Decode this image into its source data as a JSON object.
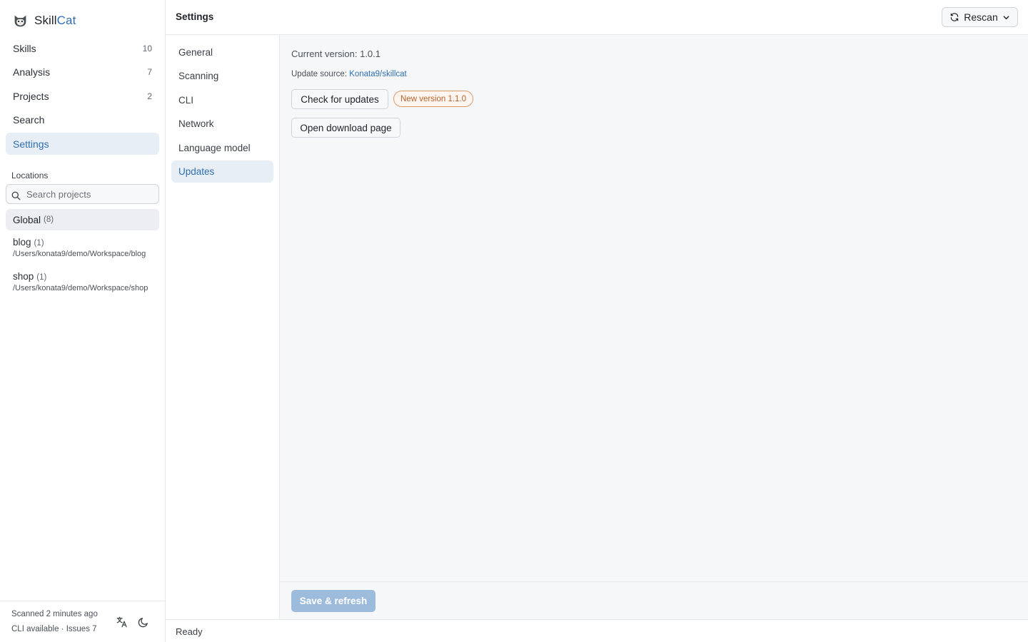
{
  "brand": {
    "name_part1": "Skill",
    "name_part2": "Cat",
    "logo_icon": "cat-logo-icon",
    "accent": "#2f6fb1"
  },
  "sidebar": {
    "items": [
      {
        "label": "Skills",
        "count": "10"
      },
      {
        "label": "Analysis",
        "count": "7"
      },
      {
        "label": "Projects",
        "count": "2"
      },
      {
        "label": "Search",
        "count": ""
      },
      {
        "label": "Settings",
        "count": "",
        "active": true
      }
    ],
    "locations_title": "Locations",
    "search_placeholder": "Search projects",
    "global": {
      "label": "Global",
      "count": "(8)"
    },
    "projects": [
      {
        "name": "blog",
        "count": "(1)",
        "path": "/Users/konata9/demo/Workspace/blog"
      },
      {
        "name": "shop",
        "count": "(1)",
        "path": "/Users/konata9/demo/Workspace/shop"
      }
    ],
    "footer": {
      "scanned": "Scanned 2 minutes ago",
      "cli_status": "CLI available · Issues 7",
      "language_icon": "translate-icon",
      "theme_icon": "moon-icon"
    }
  },
  "header": {
    "title": "Settings",
    "rescan_label": "Rescan",
    "rescan_icon": "refresh-icon",
    "menu_icon": "chevron-down-icon"
  },
  "settings_nav": [
    {
      "label": "General"
    },
    {
      "label": "Scanning"
    },
    {
      "label": "CLI"
    },
    {
      "label": "Network"
    },
    {
      "label": "Language model"
    },
    {
      "label": "Updates",
      "active": true
    }
  ],
  "updates": {
    "current_version": "Current version: 1.0.1",
    "source_label": "Update source:",
    "source_link": "Konata9/skillcat",
    "check_button": "Check for updates",
    "new_version_badge": "New version 1.1.0",
    "download_button": "Open download page",
    "badge_color": "#b5622a"
  },
  "save_button": "Save & refresh",
  "status": "Ready"
}
